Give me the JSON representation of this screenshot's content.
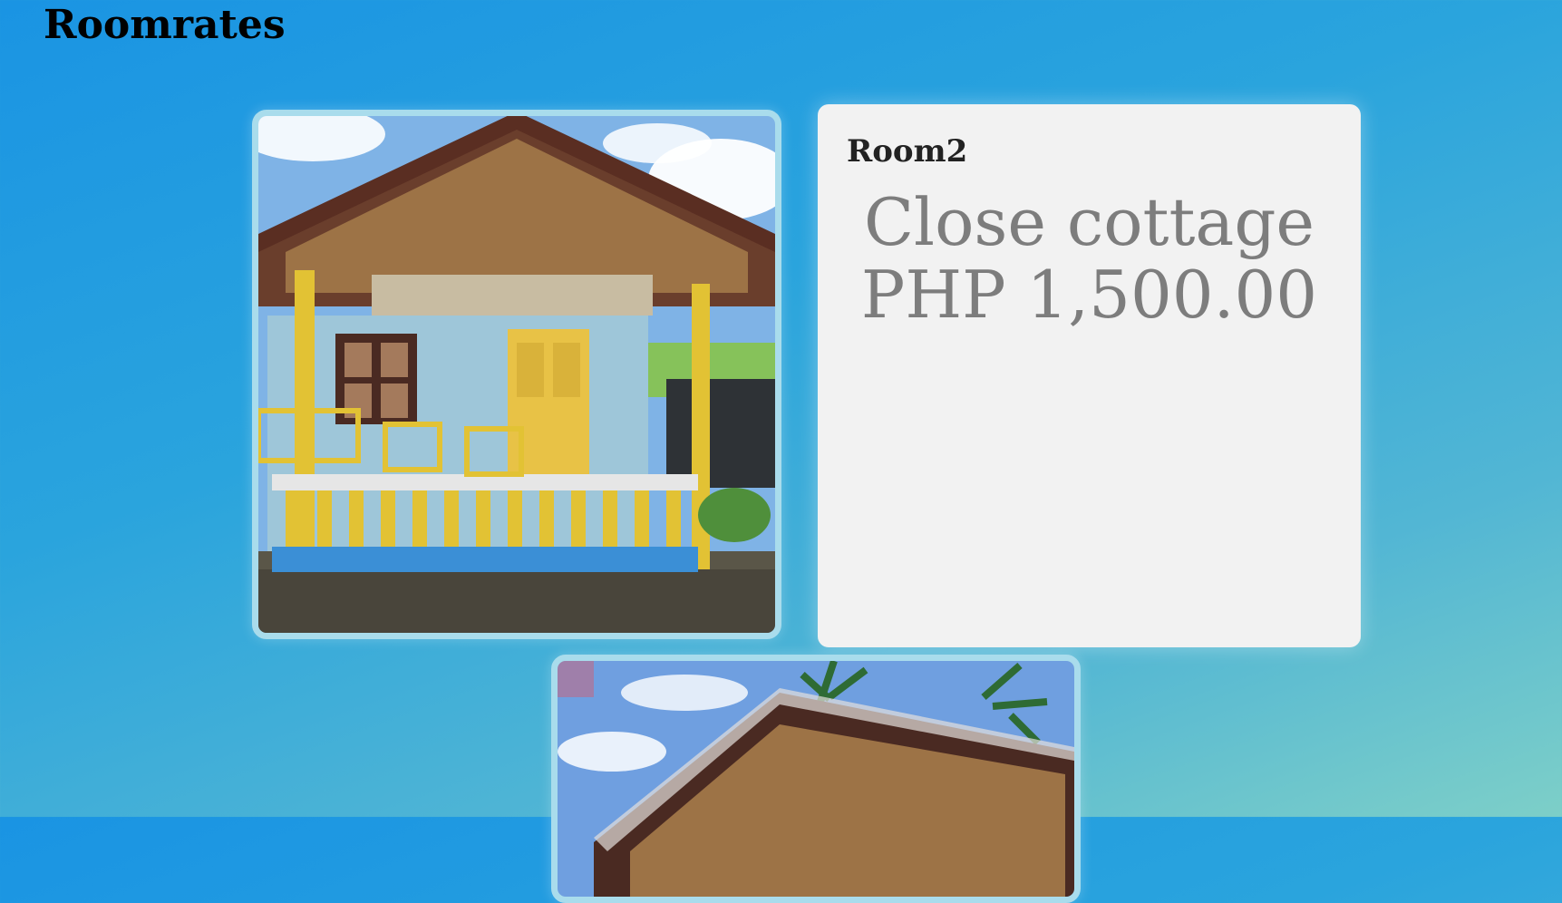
{
  "page": {
    "title": "Roomrates"
  },
  "room": {
    "name": "Room2",
    "description": "Close cottage",
    "price": "PHP 1,500.00"
  },
  "images": [
    {
      "subject": "cottage-photo",
      "description": "Nipa cottage with yellow bamboo porch and blue walls"
    },
    {
      "subject": "cottage-photo",
      "description": "Cottage roof with palm trees and blue sky"
    }
  ],
  "colors": {
    "background_start": "#1a94e3",
    "background_end": "#7dcfc8",
    "card_background": "#f2f2f2",
    "photo_border": "#a9dcec",
    "price_text": "#7d7d7d"
  }
}
